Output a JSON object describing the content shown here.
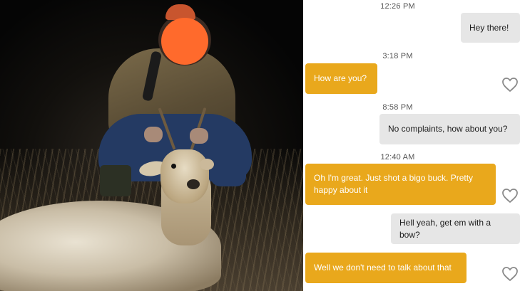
{
  "photo": {
    "description_hidden": ""
  },
  "chat": {
    "messages": [
      {
        "time": "12:26 PM",
        "sender": "me",
        "text": "Hey there!"
      },
      {
        "time": "3:18 PM",
        "sender": "them",
        "text": "How are you?"
      },
      {
        "time": "8:58 PM",
        "sender": "me",
        "text": "No complaints, how about you?"
      },
      {
        "time": "12:40 AM",
        "sender": "them",
        "text": "Oh I'm great. Just shot a bigo buck. Pretty happy about it"
      },
      {
        "time": "",
        "sender": "me",
        "text": "Hell yeah, get em with a bow?"
      },
      {
        "time": "",
        "sender": "them",
        "text": "Well we don't need to talk about that"
      }
    ],
    "colors": {
      "incoming": "#e9a81c",
      "outgoing": "#e6e6e6",
      "heart": "#8a8a8a"
    },
    "icons": {
      "like": "heart-outline-icon"
    }
  }
}
